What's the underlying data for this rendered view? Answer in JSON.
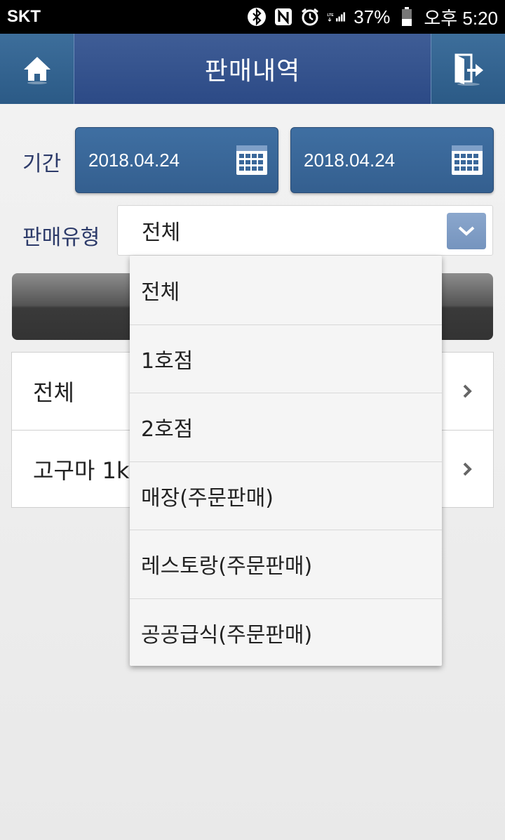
{
  "status_bar": {
    "carrier": "SKT",
    "battery": "37%",
    "time": "오후 5:20",
    "network": "LTE"
  },
  "header": {
    "title": "판매내역"
  },
  "period": {
    "label": "기간",
    "start_date": "2018.04.24",
    "end_date": "2018.04.24"
  },
  "sales_type": {
    "label": "판매유형",
    "selected": "전체"
  },
  "list": {
    "items": [
      {
        "label": "전체"
      },
      {
        "label": "고구마 1k"
      }
    ]
  },
  "dropdown": {
    "options": [
      "전체",
      "1호점",
      "2호점",
      "매장(주문판매)",
      "레스토랑(주문판매)",
      "공공급식(주문판매)"
    ]
  },
  "colors": {
    "header": "#2f4d8a",
    "date_button": "#3a679a",
    "label_text": "#2d3b6a"
  }
}
